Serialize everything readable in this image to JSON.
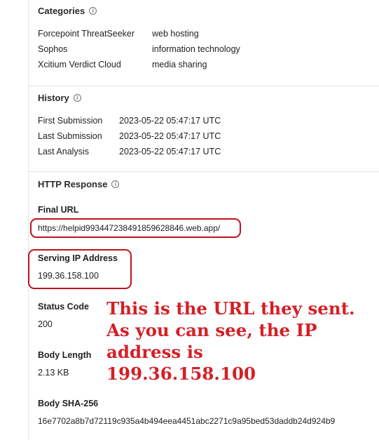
{
  "categories": {
    "title": "Categories",
    "rows": [
      {
        "vendor": "Forcepoint ThreatSeeker",
        "category": "web hosting"
      },
      {
        "vendor": "Sophos",
        "category": "information technology"
      },
      {
        "vendor": "Xcitium Verdict Cloud",
        "category": "media sharing"
      }
    ]
  },
  "history": {
    "title": "History",
    "rows": [
      {
        "label": "First Submission",
        "value": "2023-05-22 05:47:17 UTC"
      },
      {
        "label": "Last Submission",
        "value": "2023-05-22 05:47:17 UTC"
      },
      {
        "label": "Last Analysis",
        "value": "2023-05-22 05:47:17 UTC"
      }
    ]
  },
  "http_response": {
    "title": "HTTP Response",
    "final_url_label": "Final URL",
    "final_url": "https://helpid993447238491859628846.web.app/",
    "serving_ip_label": "Serving IP Address",
    "serving_ip": "199.36.158.100",
    "status_code_label": "Status Code",
    "status_code": "200",
    "body_length_label": "Body Length",
    "body_length": "2.13 KB",
    "body_sha_label": "Body SHA-256",
    "body_sha": "16e7702a8b7d72119c935a4b494eea4451abc2271c9a95bed53daddb24d924b9"
  },
  "annotation": {
    "lines": [
      "This is the URL they sent.",
      "As you can see, the IP",
      "address is",
      "199.36.158.100"
    ],
    "color": "#d41f26"
  },
  "icons": {
    "info": "info-icon"
  }
}
